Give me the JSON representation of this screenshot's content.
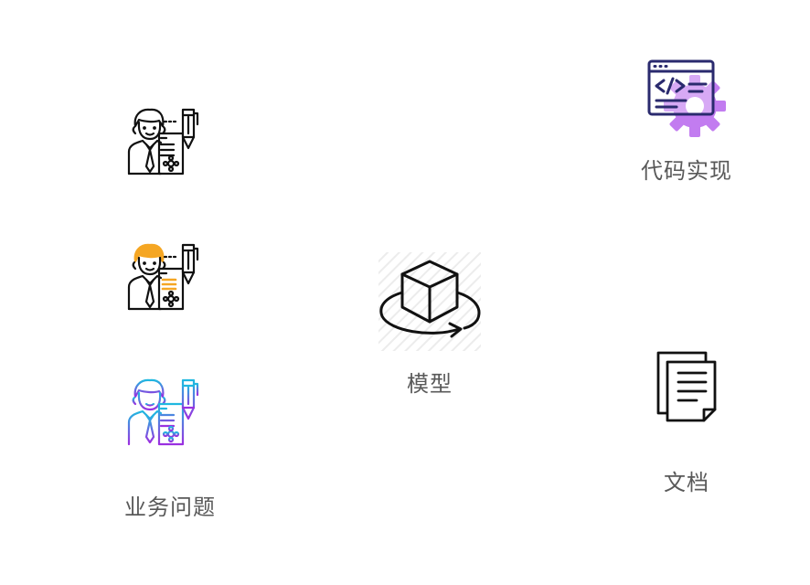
{
  "nodes": {
    "business": {
      "label": "业务问题"
    },
    "model": {
      "label": "模型"
    },
    "code": {
      "label": "代码实现"
    },
    "docs": {
      "label": "文档"
    }
  },
  "icons": {
    "person_black": "person-document-pen-icon",
    "person_orange": "person-document-pen-icon",
    "person_gradient": "person-document-pen-icon",
    "model": "cube-rotate-icon",
    "code": "code-window-gear-icon",
    "docs": "documents-icon"
  },
  "colors": {
    "label": "#595959",
    "icon_line": "#111111",
    "accent_orange": "#f5a623",
    "gradient_start": "#1fb8e0",
    "gradient_end": "#9b2fe0",
    "code_window": "#2a2a6e",
    "gear": "#c27cf0"
  }
}
